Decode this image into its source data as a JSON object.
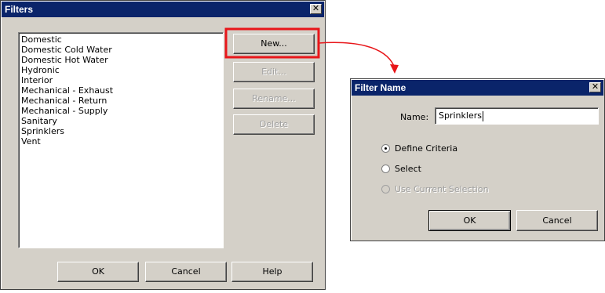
{
  "filters_dialog": {
    "title": "Filters",
    "close_glyph": "✕",
    "list_items": [
      "Domestic",
      "Domestic Cold Water",
      "Domestic Hot Water",
      "Hydronic",
      "Interior",
      "Mechanical - Exhaust",
      "Mechanical - Return",
      "Mechanical - Supply",
      "Sanitary",
      "Sprinklers",
      "Vent"
    ],
    "buttons": {
      "new": "New...",
      "edit": "Edit...",
      "rename": "Rename...",
      "delete": "Delete",
      "ok": "OK",
      "cancel": "Cancel",
      "help": "Help"
    }
  },
  "filter_name_dialog": {
    "title": "Filter Name",
    "close_glyph": "✕",
    "name_label": "Name:",
    "name_value": "Sprinklers",
    "radio_options": {
      "define_criteria": "Define Criteria",
      "select": "Select",
      "use_current_selection": "Use Current Selection"
    },
    "selected_option": "define_criteria",
    "buttons": {
      "ok": "OK",
      "cancel": "Cancel"
    }
  },
  "annotation": {
    "highlight_color": "#e8161a"
  }
}
